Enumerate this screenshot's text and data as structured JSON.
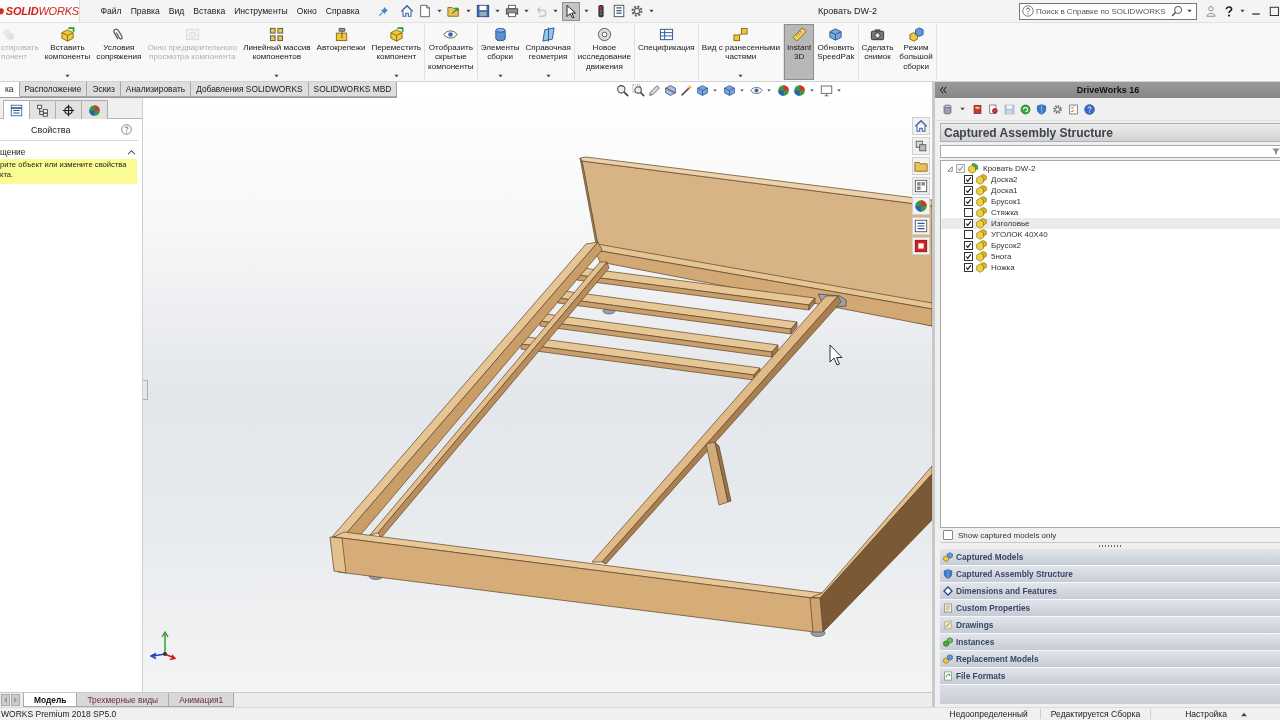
{
  "title_bar": {
    "logo": "**SOLID**WORKS",
    "menu": [
      "Файл",
      "Правка",
      "Вид",
      "Вставка",
      "Инструменты",
      "Окно",
      "Справка"
    ],
    "quick_access": [
      {
        "selected": false,
        "disabled": false
      },
      {
        "selected": false,
        "disabled": false
      },
      {
        "selected": false,
        "disabled": false
      },
      {
        "selected": false,
        "disabled": false
      },
      {
        "selected": false,
        "disabled": false
      },
      {
        "selected": false,
        "disabled": true
      },
      {
        "selected": true,
        "disabled": false
      },
      {
        "selected": false,
        "disabled": false
      },
      {
        "selected": false,
        "disabled": false
      },
      {
        "selected": false,
        "disabled": false
      }
    ],
    "document_title": "Кровать DW-2",
    "search": {
      "placeholder": "Поиск в Справке по SOLIDWORKS"
    }
  },
  "ribbon": {
    "groups": [
      [
        {
          "label": "стировать\nпонент",
          "disabled": true,
          "dropdown": false,
          "selected": false
        },
        {
          "label": "Вставить\nкомпоненты",
          "disabled": false,
          "dropdown": true,
          "selected": false
        },
        {
          "label": "Условия\nсопряжения",
          "disabled": false,
          "dropdown": false,
          "selected": false
        },
        {
          "label": "Окно предварительного\nпросмотра компонента",
          "disabled": true,
          "dropdown": false,
          "selected": false
        },
        {
          "label": "Линейный массив\nкомпонентов",
          "disabled": false,
          "dropdown": true,
          "selected": false
        },
        {
          "label": "Автокрепежи",
          "disabled": false,
          "dropdown": false,
          "selected": false
        },
        {
          "label": "Переместить\nкомпонент",
          "disabled": false,
          "dropdown": true,
          "selected": false
        }
      ],
      [
        {
          "label": "Отобразить\nскрытые\nкомпоненты",
          "disabled": false,
          "dropdown": false,
          "selected": false
        }
      ],
      [
        {
          "label": "Элементы\nсборки",
          "disabled": false,
          "dropdown": true,
          "selected": false
        },
        {
          "label": "Справочная\nгеометрия",
          "disabled": false,
          "dropdown": true,
          "selected": false
        }
      ],
      [
        {
          "label": "Новое\nисследование\nдвижения",
          "disabled": false,
          "dropdown": false,
          "selected": false
        }
      ],
      [
        {
          "label": "Спецификация",
          "disabled": false,
          "dropdown": false,
          "selected": false
        }
      ],
      [
        {
          "label": "Вид с разнесенными\nчастями",
          "disabled": false,
          "dropdown": true,
          "selected": false
        }
      ],
      [
        {
          "label": "Instant\n3D",
          "disabled": false,
          "dropdown": false,
          "selected": true
        },
        {
          "label": "Обновить\nSpeedPak",
          "disabled": false,
          "dropdown": false,
          "selected": false
        }
      ],
      [
        {
          "label": "Сделать\nснимок",
          "disabled": false,
          "dropdown": false,
          "selected": false
        },
        {
          "label": "Режим\nбольшой\nсборки",
          "disabled": false,
          "dropdown": false,
          "selected": false
        }
      ]
    ]
  },
  "command_tabs": [
    {
      "label": "ка",
      "selected": true
    },
    {
      "label": "Расположение",
      "selected": false
    },
    {
      "label": "Эскиз",
      "selected": false
    },
    {
      "label": "Анализировать",
      "selected": false
    },
    {
      "label": "Добавления SOLIDWORKS",
      "selected": false
    },
    {
      "label": "SOLIDWORKS MBD",
      "selected": false
    }
  ],
  "left_panel": {
    "tabs": [
      {
        "selected": true
      },
      {
        "selected": false
      },
      {
        "selected": false
      },
      {
        "selected": false
      }
    ],
    "title": "Свойства",
    "section": {
      "title": "щение",
      "expanded": true,
      "message": "рите объект или измените свойства\nкта."
    }
  },
  "driveworks": {
    "title": "DriveWorks 16",
    "toolbar": [
      {
        "disabled": false
      },
      {
        "disabled": false
      },
      {
        "disabled": false
      },
      {
        "disabled": true
      },
      {
        "disabled": false
      },
      {
        "disabled": false
      },
      {
        "disabled": false
      },
      {
        "disabled": false
      },
      {
        "disabled": false
      }
    ],
    "heading": "Captured Assembly Structure",
    "tree": [
      {
        "label": "Кровать DW-2",
        "kind": "assembly",
        "checked": true,
        "disabled": true,
        "selected": false,
        "expanded": true,
        "children": [
          {
            "label": "Доска2",
            "kind": "part",
            "checked": true,
            "disabled": false,
            "selected": false
          },
          {
            "label": "Доска1",
            "kind": "part",
            "checked": true,
            "disabled": false,
            "selected": false
          },
          {
            "label": "Брусок1",
            "kind": "part",
            "checked": true,
            "disabled": false,
            "selected": false
          },
          {
            "label": "Стяжка",
            "kind": "part",
            "checked": false,
            "disabled": false,
            "selected": false
          },
          {
            "label": "Изголовье",
            "kind": "part",
            "checked": true,
            "disabled": false,
            "selected": true
          },
          {
            "label": "УГОЛОК 40Х40",
            "kind": "part",
            "checked": false,
            "disabled": false,
            "selected": false
          },
          {
            "label": "Брусок2",
            "kind": "part",
            "checked": true,
            "disabled": false,
            "selected": false
          },
          {
            "label": "5нога",
            "kind": "part",
            "checked": true,
            "disabled": false,
            "selected": false
          },
          {
            "label": "Ножка",
            "kind": "part",
            "checked": true,
            "disabled": false,
            "selected": false
          }
        ]
      }
    ],
    "show_captured_only": {
      "label": "Show captured models only",
      "checked": false
    },
    "sections": [
      {
        "label": "Captured Models"
      },
      {
        "label": "Captured Assembly Structure"
      },
      {
        "label": "Dimensions and Features"
      },
      {
        "label": "Custom Properties"
      },
      {
        "label": "Drawings"
      },
      {
        "label": "Instances"
      },
      {
        "label": "Replacement Models"
      },
      {
        "label": "File Formats"
      }
    ]
  },
  "bottom_tabs": [
    {
      "label": "Модель",
      "selected": true
    },
    {
      "label": "Трехмерные виды",
      "selected": false
    },
    {
      "label": "Анимация1",
      "selected": false
    }
  ],
  "status_bar": {
    "product": "WORKS Premium 2018 SP5.0",
    "fields": [
      "Недоопределенный",
      "Редактируется Сборка",
      "Настройка"
    ]
  }
}
